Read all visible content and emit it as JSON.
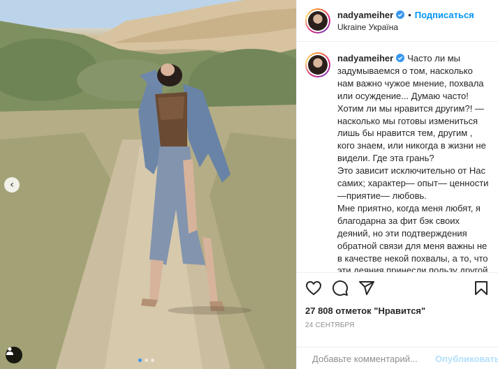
{
  "post": {
    "username": "nadyameiher",
    "follow_label": "Подписаться",
    "separator": "•",
    "location": "Ukraine Україна",
    "caption": "Часто ли мы задумываемся о том, насколько нам важно чужое мнение, похвала или осуждение... Думаю часто! Хотим ли мы нравится другим?! — насколько мы готовы измениться лишь бы нравится тем, другим , кого знаем, или никогда в жизни не видели. Где эта грань?\nЭто зависит исключительно от Нас самих; характер— опыт— ценности—приятие— любовь.\nМне приятно, когда меня любят, я благодарна за фит бэк своих деяний, но эти подтверждения обратной связи для меня важны не в качестве некой похвалы, а то, что эти деяния принесли пользу другой стороне в малом или большом. Вот что мне важно!\nИ тем более не трогает чья-то обида не мир... Жизнь, уходящего, оживно",
    "likes": "27 808 отметок \"Нравится\"",
    "date": "24 СЕНТЯБРЯ"
  },
  "comment": {
    "placeholder": "Добавьте комментарий...",
    "publish_label": "Опубликовать"
  },
  "icons": {
    "verified": "verified-badge-icon",
    "like": "heart-icon",
    "comment": "comment-bubble-icon",
    "share": "paper-plane-icon",
    "save": "bookmark-icon",
    "emoji": "smiley-icon",
    "prev": "chevron-left-icon",
    "tag": "user-tag-icon"
  },
  "colors": {
    "accent": "#0095f6",
    "publish_disabled": "#b2dffc",
    "verified": "#3897f0",
    "muted": "#8e8e8e"
  },
  "carousel": {
    "slide_count": 3,
    "active_index": 0
  }
}
